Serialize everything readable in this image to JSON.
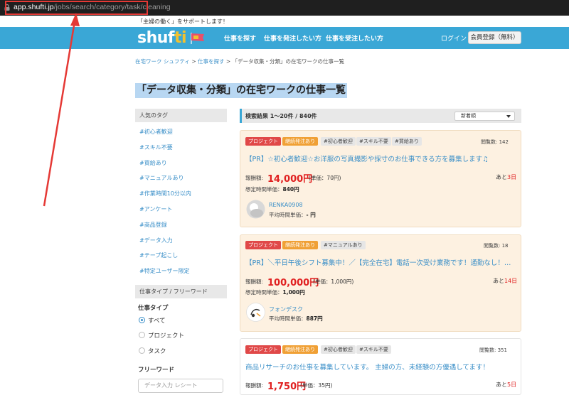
{
  "browser": {
    "url_host": "app.shufti.jp",
    "url_path": "/jobs/search/category/task/cleaning"
  },
  "header": {
    "tagline": "「主婦の働く」をサポートします！",
    "logo_main": "shuf",
    "logo_accent": "ti",
    "nav": [
      "仕事を探す",
      "仕事を発注したい方",
      "仕事を受注したい方"
    ],
    "login": "ログイン",
    "signup": "会員登録（無料）"
  },
  "breadcrumb": {
    "home": "在宅ワーク シュフティ",
    "sep1": " > ",
    "find": "仕事を探す",
    "sep2": " > ",
    "current": "「データ収集・分類」の在宅ワークの仕事一覧"
  },
  "page_title": "「データ収集・分類」の在宅ワークの仕事一覧",
  "sidebar": {
    "popular_tags_heading": "人気のタグ",
    "tags": [
      "#初心者歓迎",
      "#スキル不要",
      "#買給あり",
      "#マニュアルあり",
      "#作業時間10分以内",
      "#アンケート",
      "#商品登録",
      "#データ入力",
      "#テープ起こし",
      "#特定ユーザー限定"
    ],
    "type_heading": "仕事タイプ / フリーワード",
    "type_label": "仕事タイプ",
    "type_options": [
      "すべて",
      "プロジェクト",
      "タスク"
    ],
    "freeword_label": "フリーワード",
    "freeword_placeholder": "データ入力 レシート"
  },
  "results": {
    "summary": "検索結果  1〜20件 / 840件",
    "sort": "新着順"
  },
  "jobs": [
    {
      "badges": [
        "プロジェクト",
        "継続発注あり",
        "#初心者歓迎",
        "#スキル不要",
        "#買給あり"
      ],
      "views": "閲覧数: 142",
      "title": "【PR】☆初心者歓迎☆お洋服の写真撮影や採寸のお仕事できる方を募集します♫",
      "pay_label": "報酬額:",
      "pay": "14,000円",
      "unit": "(単価：70円)",
      "remain_prefix": "あと",
      "remain_days": "3日",
      "est_label": "想定時間単価：",
      "est_value": "840円",
      "client": "RENKA0908",
      "client_avg_label": "平均時間単価：",
      "client_avg_value": "- 円"
    },
    {
      "badges": [
        "プロジェクト",
        "継続発注あり",
        "#マニュアルあり"
      ],
      "views": "閲覧数: 18",
      "title": "【PR】＼平日午後シフト募集中！／【完全在宅】電話一次受け業務です！通勤なし！…",
      "pay_label": "報酬額:",
      "pay": "100,000円",
      "unit": "(単価：1,000円)",
      "remain_prefix": "あと",
      "remain_days": "14日",
      "est_label": "想定時間単価：",
      "est_value": "1,000円",
      "client": "フォンデスク",
      "client_avg_label": "平均時間単価：",
      "client_avg_value": "887円"
    },
    {
      "badges": [
        "プロジェクト",
        "継続発注あり",
        "#初心者歓迎",
        "#スキル不要"
      ],
      "views": "閲覧数: 351",
      "title": "商品リサーチのお仕事を募集しています。 主婦の方、未経験の方優遇してます！",
      "pay_label": "報酬額:",
      "pay": "1,750円",
      "unit": "(単価：35円)",
      "remain_prefix": "あと",
      "remain_days": "5日"
    }
  ],
  "colors": {
    "nav_blue": "#3aa7d6",
    "title_highlight": "#b8d7f2",
    "card_bg": "#fdf1e1",
    "badge_red": "#e04848",
    "badge_orange": "#f0a035",
    "price_red": "#e02020",
    "annotation_red": "#e53935"
  }
}
